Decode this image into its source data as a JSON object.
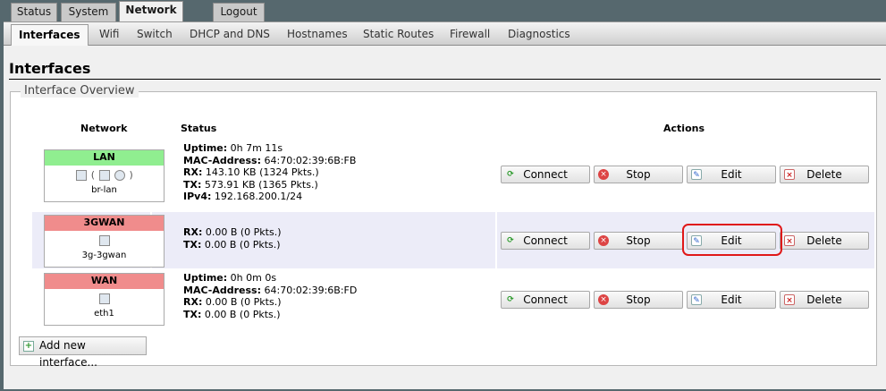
{
  "top_tabs": [
    {
      "label": "Status"
    },
    {
      "label": "System"
    },
    {
      "label": "Network",
      "active": true
    },
    {
      "label": "Logout"
    }
  ],
  "sub_tabs": [
    {
      "label": "Interfaces",
      "active": true
    },
    {
      "label": "Wifi"
    },
    {
      "label": "Switch"
    },
    {
      "label": "DHCP and DNS"
    },
    {
      "label": "Hostnames"
    },
    {
      "label": "Static Routes"
    },
    {
      "label": "Firewall"
    },
    {
      "label": "Diagnostics"
    }
  ],
  "page": {
    "title": "Interfaces",
    "section_legend": "Interface Overview"
  },
  "table": {
    "headers": {
      "network": "Network",
      "status": "Status",
      "actions": "Actions"
    },
    "rows": [
      {
        "name": "LAN",
        "header_color": "#90ee90",
        "device": "br-lan",
        "icons_text": "(",
        "icons_text_close": ")",
        "status": [
          {
            "label": "Uptime:",
            "value": " 0h 7m 11s"
          },
          {
            "label": "MAC-Address:",
            "value": " 64:70:02:39:6B:FB"
          },
          {
            "label": "RX:",
            "value": " 143.10 KB (1324 Pkts.)"
          },
          {
            "label": "TX:",
            "value": " 573.91 KB (1365 Pkts.)"
          },
          {
            "label": "IPv4:",
            "value": " 192.168.200.1/24"
          }
        ]
      },
      {
        "name": "3GWAN",
        "header_color": "#f08c8c",
        "device": "3g-3gwan",
        "status": [
          {
            "label": "RX:",
            "value": " 0.00 B (0 Pkts.)"
          },
          {
            "label": "TX:",
            "value": " 0.00 B (0 Pkts.)"
          }
        ]
      },
      {
        "name": "WAN",
        "header_color": "#f08c8c",
        "device": "eth1",
        "status": [
          {
            "label": "Uptime:",
            "value": " 0h 0m 0s"
          },
          {
            "label": "MAC-Address:",
            "value": " 64:70:02:39:6B:FD"
          },
          {
            "label": "RX:",
            "value": " 0.00 B (0 Pkts.)"
          },
          {
            "label": "TX:",
            "value": " 0.00 B (0 Pkts.)"
          }
        ]
      }
    ]
  },
  "actions": {
    "connect": "Connect",
    "stop": "Stop",
    "edit": "Edit",
    "delete": "Delete"
  },
  "add_interface_label": "Add new interface...",
  "colors": {
    "lan_green": "#90ee90",
    "wan_red": "#f08c8c",
    "highlight": "#e01818"
  }
}
